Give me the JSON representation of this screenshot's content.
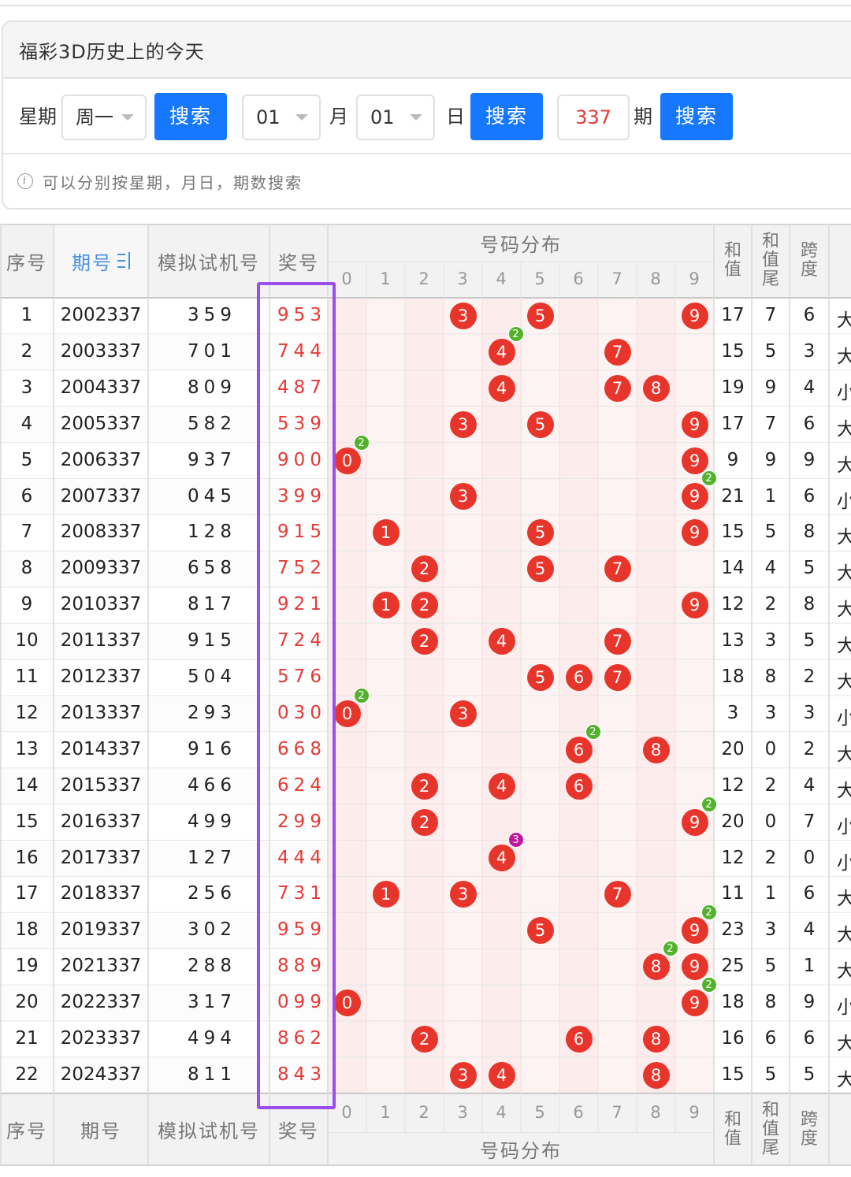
{
  "panel": {
    "title": "福彩3D历史上的今天",
    "weekday_label": "星期",
    "weekday_value": "周一",
    "search_label": "搜索",
    "month_value": "01",
    "month_label": "月",
    "day_value": "01",
    "day_label": "日",
    "issue_value": "337",
    "issue_label": "期",
    "tip": "可以分别按星期，月日，期数搜索"
  },
  "table": {
    "headers": {
      "index": "序号",
      "issue": "期号",
      "sim": "模拟试机号",
      "win": "奖号",
      "dist": "号码分布",
      "sum": [
        "和",
        "值"
      ],
      "sum_tail": [
        "和",
        "值",
        "尾"
      ],
      "span": [
        "跨",
        "度"
      ]
    },
    "digits": [
      "0",
      "1",
      "2",
      "3",
      "4",
      "5",
      "6",
      "7",
      "8",
      "9"
    ],
    "rows": [
      {
        "idx": "1",
        "issue": "2002337",
        "sim": "359",
        "win": "953",
        "sum": "17",
        "tail": "7",
        "span": "6",
        "dx": "大"
      },
      {
        "idx": "2",
        "issue": "2003337",
        "sim": "701",
        "win": "744",
        "sum": "15",
        "tail": "5",
        "span": "3",
        "dx": "大"
      },
      {
        "idx": "3",
        "issue": "2004337",
        "sim": "809",
        "win": "487",
        "sum": "19",
        "tail": "9",
        "span": "4",
        "dx": "小"
      },
      {
        "idx": "4",
        "issue": "2005337",
        "sim": "582",
        "win": "539",
        "sum": "17",
        "tail": "7",
        "span": "6",
        "dx": "大"
      },
      {
        "idx": "5",
        "issue": "2006337",
        "sim": "937",
        "win": "900",
        "sum": "9",
        "tail": "9",
        "span": "9",
        "dx": "大"
      },
      {
        "idx": "6",
        "issue": "2007337",
        "sim": "045",
        "win": "399",
        "sum": "21",
        "tail": "1",
        "span": "6",
        "dx": "小"
      },
      {
        "idx": "7",
        "issue": "2008337",
        "sim": "128",
        "win": "915",
        "sum": "15",
        "tail": "5",
        "span": "8",
        "dx": "大"
      },
      {
        "idx": "8",
        "issue": "2009337",
        "sim": "658",
        "win": "752",
        "sum": "14",
        "tail": "4",
        "span": "5",
        "dx": "大"
      },
      {
        "idx": "9",
        "issue": "2010337",
        "sim": "817",
        "win": "921",
        "sum": "12",
        "tail": "2",
        "span": "8",
        "dx": "大"
      },
      {
        "idx": "10",
        "issue": "2011337",
        "sim": "915",
        "win": "724",
        "sum": "13",
        "tail": "3",
        "span": "5",
        "dx": "大"
      },
      {
        "idx": "11",
        "issue": "2012337",
        "sim": "504",
        "win": "576",
        "sum": "18",
        "tail": "8",
        "span": "2",
        "dx": "大"
      },
      {
        "idx": "12",
        "issue": "2013337",
        "sim": "293",
        "win": "030",
        "sum": "3",
        "tail": "3",
        "span": "3",
        "dx": "小"
      },
      {
        "idx": "13",
        "issue": "2014337",
        "sim": "916",
        "win": "668",
        "sum": "20",
        "tail": "0",
        "span": "2",
        "dx": "大"
      },
      {
        "idx": "14",
        "issue": "2015337",
        "sim": "466",
        "win": "624",
        "sum": "12",
        "tail": "2",
        "span": "4",
        "dx": "大"
      },
      {
        "idx": "15",
        "issue": "2016337",
        "sim": "499",
        "win": "299",
        "sum": "20",
        "tail": "0",
        "span": "7",
        "dx": "小"
      },
      {
        "idx": "16",
        "issue": "2017337",
        "sim": "127",
        "win": "444",
        "sum": "12",
        "tail": "2",
        "span": "0",
        "dx": "小"
      },
      {
        "idx": "17",
        "issue": "2018337",
        "sim": "256",
        "win": "731",
        "sum": "11",
        "tail": "1",
        "span": "6",
        "dx": "大"
      },
      {
        "idx": "18",
        "issue": "2019337",
        "sim": "302",
        "win": "959",
        "sum": "23",
        "tail": "3",
        "span": "4",
        "dx": "大"
      },
      {
        "idx": "19",
        "issue": "2021337",
        "sim": "288",
        "win": "889",
        "sum": "25",
        "tail": "5",
        "span": "1",
        "dx": "大"
      },
      {
        "idx": "20",
        "issue": "2022337",
        "sim": "317",
        "win": "099",
        "sum": "18",
        "tail": "8",
        "span": "9",
        "dx": "小"
      },
      {
        "idx": "21",
        "issue": "2023337",
        "sim": "494",
        "win": "862",
        "sum": "16",
        "tail": "6",
        "span": "6",
        "dx": "大"
      },
      {
        "idx": "22",
        "issue": "2024337",
        "sim": "811",
        "win": "843",
        "sum": "15",
        "tail": "5",
        "span": "5",
        "dx": "大"
      }
    ]
  },
  "colors": {
    "accent": "#1677ff",
    "win_number": "#e53935",
    "ball": "#e8352b",
    "badge_double": "#52b22e",
    "badge_triple": "#c0179e",
    "highlight_box": "#9a4ef1",
    "dist_bg": "#fdeeee"
  }
}
